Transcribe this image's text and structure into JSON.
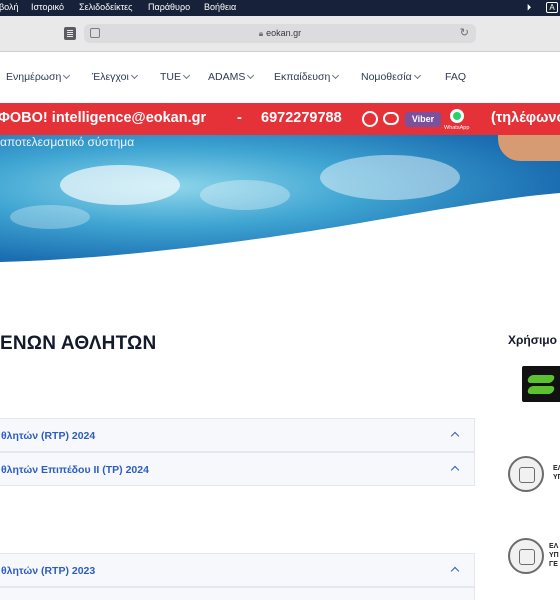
{
  "menubar": {
    "items": [
      "βολή",
      "Ιστορικό",
      "Σελιδοδείκτες",
      "Παράθυρο",
      "Βοήθεια"
    ],
    "kbd": "A"
  },
  "browser": {
    "url": "eokan.gr"
  },
  "nav": {
    "items": [
      "Ενημέρωση",
      "Έλεγχοι",
      "TUE",
      "ADAMS",
      "Εκπαίδευση",
      "Νομοθεσία",
      "FAQ"
    ]
  },
  "banner": {
    "text_email": "ΦΟΒΟ! intelligence@eokan.gr",
    "separator": "-",
    "phone": "6972279788",
    "viber": "Viber",
    "whatsapp": "WhatsApp",
    "trailing": "(τηλέφωνο"
  },
  "hero": {
    "subtitle": "αποτελεσματικό σύστημα"
  },
  "main": {
    "heading": "ΕΝΩΝ ΑΘΛΗΤΩΝ",
    "accordions": [
      "θλητών (RTP) 2024",
      "θλητών Επιπέδου ΙΙ (TP) 2024",
      "θλητών (RTP) 2023"
    ]
  },
  "sidebar": {
    "title": "Χρήσιμο",
    "seal1": [
      "ΕΛ",
      "ΥΠ"
    ],
    "seal2": [
      "ΕΛ",
      "ΥΠ",
      "ΓΕ"
    ]
  }
}
